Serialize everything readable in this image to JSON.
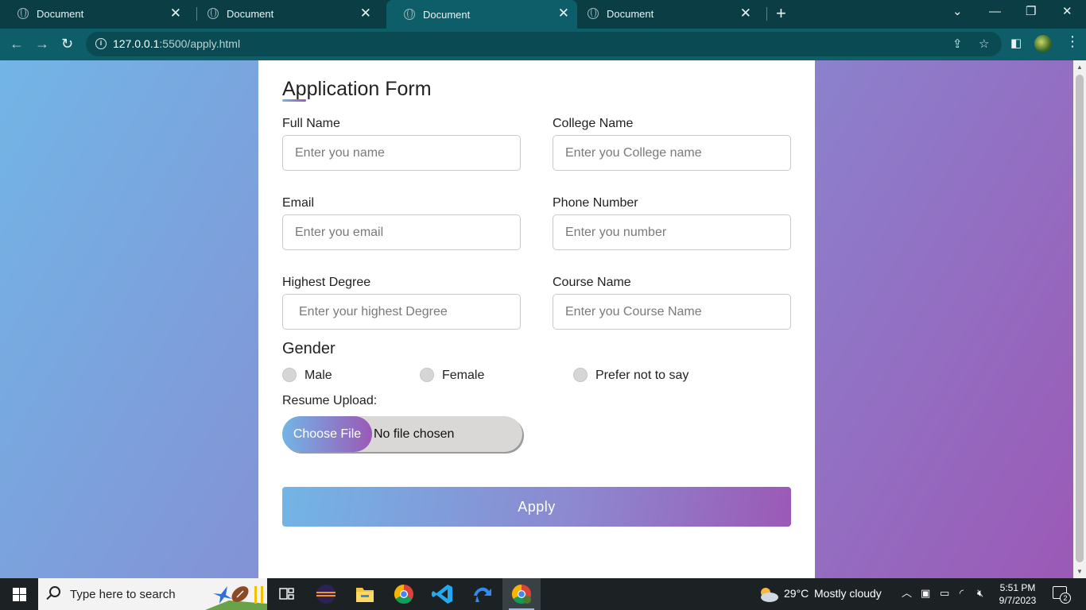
{
  "browser": {
    "tabs": [
      {
        "title": "Document",
        "active": false
      },
      {
        "title": "Document",
        "active": false
      },
      {
        "title": "Document",
        "active": true
      },
      {
        "title": "Document",
        "active": false
      }
    ],
    "url_host": "127.0.0.1",
    "url_path": ":5500/apply.html"
  },
  "form": {
    "title": "Application Form",
    "full_name": {
      "label": "Full Name",
      "placeholder": "Enter you name",
      "value": ""
    },
    "college_name": {
      "label": "College Name",
      "placeholder": "Enter you College name",
      "value": ""
    },
    "email": {
      "label": "Email",
      "placeholder": "Enter you email",
      "value": ""
    },
    "phone": {
      "label": "Phone Number",
      "placeholder": "Enter you number",
      "value": ""
    },
    "degree": {
      "label": "Highest Degree",
      "placeholder": "Enter your highest Degree",
      "value": ""
    },
    "course": {
      "label": "Course Name",
      "placeholder": "Enter you Course Name",
      "value": ""
    },
    "gender": {
      "title": "Gender",
      "options": [
        "Male",
        "Female",
        "Prefer not to say"
      ],
      "selected": null
    },
    "resume": {
      "label": "Resume Upload:",
      "button": "Choose File",
      "status": "No file chosen"
    },
    "submit_label": "Apply"
  },
  "colors": {
    "gradient_start": "#72b5e6",
    "gradient_end": "#9b59b6",
    "chrome_dark": "#0b3d44",
    "chrome_toolbar": "#0e5e69"
  },
  "taskbar": {
    "search_placeholder": "Type here to search",
    "weather_temp": "29°C",
    "weather_desc": "Mostly cloudy",
    "time": "5:51 PM",
    "date": "9/7/2023",
    "notification_count": "2",
    "apps": [
      "task-view",
      "eclipse",
      "file-explorer",
      "chrome",
      "vscode",
      "sourcetree",
      "chrome-profile"
    ]
  }
}
